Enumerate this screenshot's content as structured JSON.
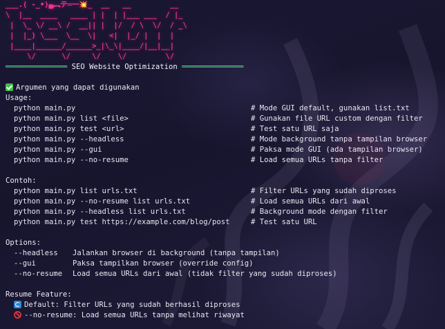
{
  "banner": {
    "art_lines": [
      "___.( -_•)▄︻テ═一💥_  __   __         __",
      "\\  |__  ____   ____ | |  | |___ ___  / |_",
      " |  \\_ \\/ __\\ /  __|| |  |/  / \\  \\/  / _\\",
      " |  |_) \\___  \\__  \\|   <|  |_/ |  |  |",
      " |____|______/______>_|\\_\\|____/|__|__|",
      "     \\/      \\/     \\/    \\/         \\/"
    ],
    "title": "SEO Website Optimization"
  },
  "header": {
    "label": "Argumen yang dapat digunakan"
  },
  "usage": {
    "heading": "Usage:",
    "rows": [
      {
        "cmd": "python main.py",
        "comment": "# Mode GUI default, gunakan list.txt"
      },
      {
        "cmd": "python main.py list <file>",
        "comment": "# Gunakan file URL custom dengan filter"
      },
      {
        "cmd": "python main.py test <url>",
        "comment": "# Test satu URL saja"
      },
      {
        "cmd": "python main.py --headless",
        "comment": "# Mode background tanpa tampilan browser"
      },
      {
        "cmd": "python main.py --gui",
        "comment": "# Paksa mode GUI (ada tampilan browser)"
      },
      {
        "cmd": "python main.py --no-resume",
        "comment": "# Load semua URLs tanpa filter"
      }
    ]
  },
  "examples": {
    "heading": "Contoh:",
    "rows": [
      {
        "cmd": "python main.py list urls.txt",
        "comment": "# Filter URLs yang sudah diproses"
      },
      {
        "cmd": "python main.py --no-resume list urls.txt",
        "comment": "# Load semua URLs dari awal"
      },
      {
        "cmd": "python main.py --headless list urls.txt",
        "comment": "# Background mode dengan filter"
      },
      {
        "cmd": "python main.py test https://example.com/blog/post",
        "comment": "# Test satu URL"
      }
    ]
  },
  "options": {
    "heading": "Options:",
    "rows": [
      {
        "flag": "--headless",
        "desc": "Jalankan browser di background (tanpa tampilan)"
      },
      {
        "flag": "--gui",
        "desc": "Paksa tampilkan browser (override config)"
      },
      {
        "flag": "--no-resume",
        "desc": "Load semua URLs dari awal (tidak filter yang sudah diproses)"
      }
    ]
  },
  "resume": {
    "heading": "Resume Feature:",
    "items": [
      {
        "icon": "refresh-icon",
        "text": "Default: Filter URLs yang sudah berhasil diproses"
      },
      {
        "icon": "no-entry-icon",
        "text": "--no-resume: Load semua URLs tanpa melihat riwayat"
      }
    ]
  },
  "colors": {
    "background": "#14122b",
    "banner": "#f0338f",
    "divider": "#4ee08a",
    "text": "#e8e6f0"
  }
}
